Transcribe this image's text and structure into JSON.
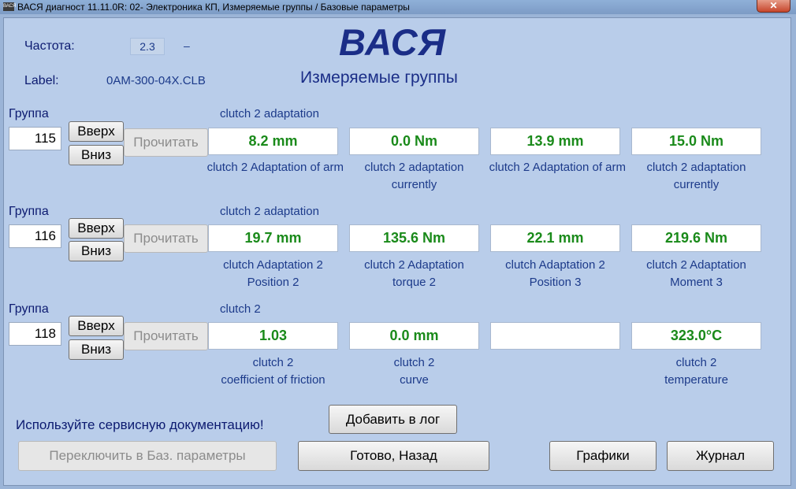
{
  "window": {
    "title": "ВАСЯ диагност 11.11.0R: 02- Электроника КП,  Измеряемые группы / Базовые параметры",
    "icon_text": "ВАСЯ",
    "close": "✕"
  },
  "header": {
    "freq_label": "Частота:",
    "freq_value": "2.3",
    "freq_dash": "–",
    "label_label": "Label:",
    "label_value": "0AM-300-04X.CLB",
    "logo": "ВАСЯ",
    "subtitle": "Измеряемые группы"
  },
  "groups": [
    {
      "label": "Группа",
      "number": "115",
      "up": "Вверх",
      "down": "Вниз",
      "read": "Прочитать",
      "heading": "clutch 2 adaptation",
      "values": [
        "8.2 mm",
        "0.0 Nm",
        "13.9 mm",
        "15.0 Nm"
      ],
      "desc": [
        [
          "clutch 2 Adaptation of arm",
          ""
        ],
        [
          "clutch 2 adaptation",
          "currently"
        ],
        [
          "clutch 2 Adaptation of arm",
          ""
        ],
        [
          "clutch 2 adaptation",
          "currently"
        ]
      ]
    },
    {
      "label": "Группа",
      "number": "116",
      "up": "Вверх",
      "down": "Вниз",
      "read": "Прочитать",
      "heading": "clutch 2 adaptation",
      "values": [
        "19.7 mm",
        "135.6 Nm",
        "22.1 mm",
        "219.6 Nm"
      ],
      "desc": [
        [
          "clutch Adaptation 2",
          "Position 2"
        ],
        [
          "clutch 2 Adaptation",
          "torque 2"
        ],
        [
          "clutch Adaptation 2",
          "Position 3"
        ],
        [
          "clutch 2 Adaptation",
          "Moment 3"
        ]
      ]
    },
    {
      "label": "Группа",
      "number": "118",
      "up": "Вверх",
      "down": "Вниз",
      "read": "Прочитать",
      "heading": "clutch 2",
      "values": [
        "1.03",
        "0.0 mm",
        "",
        "323.0°C"
      ],
      "desc": [
        [
          "clutch 2",
          "coefficient of friction"
        ],
        [
          "clutch 2",
          "curve"
        ],
        [
          "",
          ""
        ],
        [
          "clutch 2",
          "temperature"
        ]
      ]
    }
  ],
  "footer": {
    "warning": "Используйте сервисную документацию!",
    "add_log": "Добавить в лог",
    "switch": "Переключить в Баз. параметры",
    "done_back": "Готово, Назад",
    "graphs": "Графики",
    "journal": "Журнал"
  },
  "colors": {
    "value_text": "#1a8a1a",
    "label_text": "#1c3a8a",
    "background": "#b9cdea"
  }
}
